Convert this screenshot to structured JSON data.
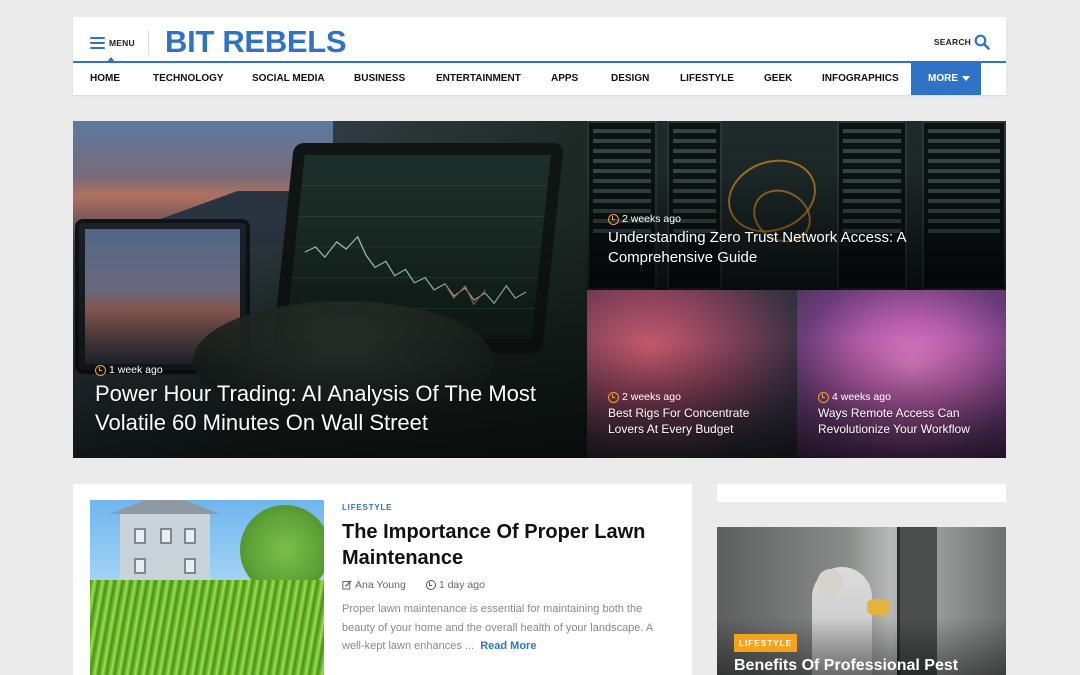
{
  "header": {
    "menu_label": "MENU",
    "logo": "BIT REBELS",
    "search_label": "SEARCH",
    "nav": [
      {
        "label": "HOME"
      },
      {
        "label": "TECHNOLOGY"
      },
      {
        "label": "SOCIAL MEDIA"
      },
      {
        "label": "BUSINESS"
      },
      {
        "label": "ENTERTAINMENT"
      },
      {
        "label": "APPS"
      },
      {
        "label": "DESIGN"
      },
      {
        "label": "LIFESTYLE"
      },
      {
        "label": "GEEK"
      },
      {
        "label": "INFOGRAPHICS"
      }
    ],
    "more_label": "MORE"
  },
  "hero": {
    "main": {
      "time": "1 week ago",
      "title_line1": "Power Hour Trading: AI Analysis Of The Most",
      "title_line2": "Volatile 60 Minutes On Wall Street"
    },
    "top_right": {
      "time": "2 weeks ago",
      "title_line1": "Understanding Zero Trust Network Access: A",
      "title_line2": "Comprehensive Guide"
    },
    "bottom_mid": {
      "time": "2 weeks ago",
      "title_line1": "Best Rigs For Concentrate",
      "title_line2": "Lovers At Every Budget"
    },
    "bottom_right": {
      "time": "4 weeks ago",
      "title_line1": "Ways Remote Access Can",
      "title_line2": "Revolutionize Your Workflow"
    }
  },
  "article": {
    "category": "LIFESTYLE",
    "title_line1": "The Importance Of Proper Lawn",
    "title_line2": "Maintenance",
    "author": "Ana Young",
    "time": "1 day ago",
    "excerpt_line1": "Proper lawn maintenance is essential for maintaining both the",
    "excerpt_line2": "beauty of your home and the overall health of your landscape. A",
    "excerpt_line3": "well-kept lawn enhances ...",
    "read_more": "Read More"
  },
  "sidebar": {
    "category": "LIFESTYLE",
    "title": "Benefits Of Professional Pest"
  },
  "colors": {
    "brand": "#2f73c7",
    "accent": "#f7a21b",
    "background": "#ebebeb"
  },
  "icons": [
    "hamburger-icon",
    "search-icon",
    "caret-down-icon",
    "clock-icon",
    "pen-icon"
  ]
}
